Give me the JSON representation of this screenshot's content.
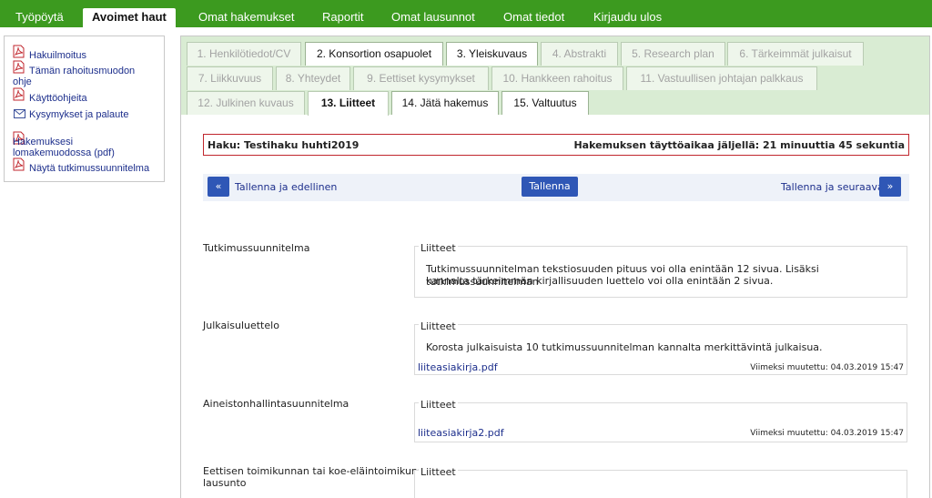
{
  "topnav": {
    "items": [
      "Työpöytä",
      "Avoimet haut",
      "Omat hakemukset",
      "Raportit",
      "Omat lausunnot",
      "Omat tiedot",
      "Kirjaudu ulos"
    ],
    "active": "Avoimet haut"
  },
  "sidebar": {
    "links": [
      {
        "label": "Hakuilmoitus",
        "icon": "pdf-icon"
      },
      {
        "label_line1": "Tämän rahoitusmuodon",
        "label_line2": "ohje",
        "icon": "pdf-icon"
      },
      {
        "label": "Käyttöohjeita",
        "icon": "pdf-icon"
      },
      {
        "label": "Kysymykset ja palaute",
        "icon": "mail-icon"
      },
      {
        "label_line1": "Hakemuksesi",
        "label_line2": "lomakemuodossa (pdf)",
        "icon": "pdf-icon"
      },
      {
        "label": "Näytä tutkimussuunnitelma",
        "icon": "pdf-icon"
      }
    ]
  },
  "tabs": [
    {
      "label": "1. Henkilötiedot/CV",
      "state": "disabled"
    },
    {
      "label": "2. Konsortion osapuolet",
      "state": "enabled"
    },
    {
      "label": "3. Yleiskuvaus",
      "state": "enabled"
    },
    {
      "label": "4. Abstrakti",
      "state": "disabled"
    },
    {
      "label": "5. Research plan",
      "state": "disabled"
    },
    {
      "label": "6. Tärkeimmät julkaisut",
      "state": "disabled"
    },
    {
      "label": "7. Liikkuvuus",
      "state": "disabled"
    },
    {
      "label": "8. Yhteydet",
      "state": "disabled"
    },
    {
      "label": "9. Eettiset kysymykset",
      "state": "disabled"
    },
    {
      "label": "10. Hankkeen rahoitus",
      "state": "disabled"
    },
    {
      "label": "11. Vastuullisen johtajan palkkaus",
      "state": "disabled"
    },
    {
      "label": "12. Julkinen kuvaus",
      "state": "disabled"
    },
    {
      "label": "13. Liitteet",
      "state": "active"
    },
    {
      "label": "14. Jätä hakemus",
      "state": "enabled"
    },
    {
      "label": "15. Valtuutus",
      "state": "enabled"
    }
  ],
  "haku": {
    "title": "Haku: Testihaku huhti2019",
    "time_left": "Hakemuksen täyttöaikaa jäljellä: 21 minuuttia 45 sekuntia"
  },
  "actions": {
    "prev_label": "Tallenna ja edellinen",
    "save_label": "Tallenna",
    "next_label": "Tallenna ja seuraava",
    "prev_icon": "«",
    "next_icon": "»"
  },
  "sections": [
    {
      "label": "Tutkimussuunnitelma",
      "box_head": "Liitteet",
      "text_line1": "Tutkimussuunnitelman tekstiosuuden pituus voi olla enintään 12 sivua. Lisäksi tutkimussuunnitelman",
      "text_line2": "kannalta tärkeimmän kirjallisuuden luettelo voi olla enintään 2 sivua."
    },
    {
      "label": "Julkaisuluettelo",
      "box_head": "Liitteet",
      "text_line1": "Korosta julkaisuista 10 tutkimussuunnitelman kannalta merkittävintä julkaisua.",
      "file": "liiteasiakirja.pdf",
      "modified": "Viimeksi muutettu: 04.03.2019 15:47"
    },
    {
      "label": "Aineistonhallintasuunnitelma",
      "box_head": "Liitteet",
      "file": "liiteasiakirja2.pdf",
      "modified": "Viimeksi muutettu: 04.03.2019 15:47"
    },
    {
      "label_line1": "Eettisen toimikunnan tai koe-eläintoimikunnan",
      "label_line2": "lausunto",
      "box_head": "Liitteet"
    }
  ],
  "colors": {
    "nav_green": "#3c9a1f",
    "tab_band": "#d9ecd3",
    "link_blue": "#1d2f8c",
    "button_blue": "#2f57b6",
    "alert_red": "#c0262d"
  }
}
